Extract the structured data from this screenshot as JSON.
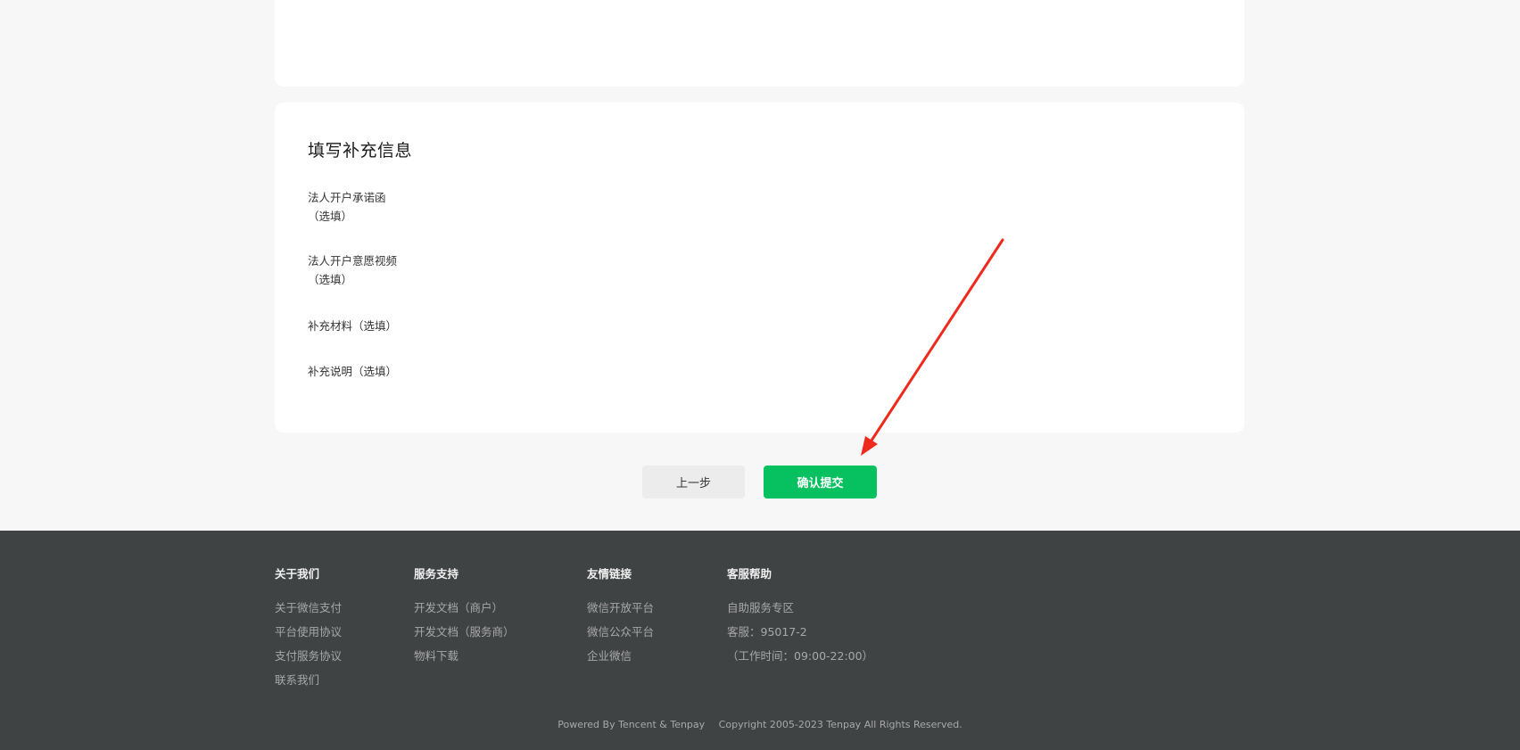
{
  "section": {
    "title": "填写补充信息",
    "fields": [
      {
        "line1": "法人开户承诺函",
        "line2": "（选填）"
      },
      {
        "line1": "法人开户意愿视频",
        "line2": "（选填）"
      },
      {
        "line1": "补充材料（选填）"
      },
      {
        "line1": "补充说明（选填）"
      }
    ]
  },
  "actions": {
    "back_label": "上一步",
    "submit_label": "确认提交",
    "submit_color": "#07c160"
  },
  "annotation": {
    "arrow_color": "#ee2a1c",
    "icon": "red-arrow-pointing-to-submit"
  },
  "footer": {
    "columns": [
      {
        "heading": "关于我们",
        "links": [
          "关于微信支付",
          "平台使用协议",
          "支付服务协议",
          "联系我们"
        ]
      },
      {
        "heading": "服务支持",
        "links": [
          "开发文档（商户）",
          "开发文档（服务商）",
          "物料下载"
        ]
      },
      {
        "heading": "友情链接",
        "links": [
          "微信开放平台",
          "微信公众平台",
          "企业微信"
        ]
      },
      {
        "heading": "客服帮助",
        "links": [
          "自助服务专区",
          "客服：95017-2",
          "（工作时间：09:00-22:00）"
        ]
      }
    ],
    "powered_by": "Powered By Tencent & Tenpay",
    "copyright": "Copyright 2005-2023 Tenpay All Rights Reserved.",
    "background": "#404344"
  }
}
